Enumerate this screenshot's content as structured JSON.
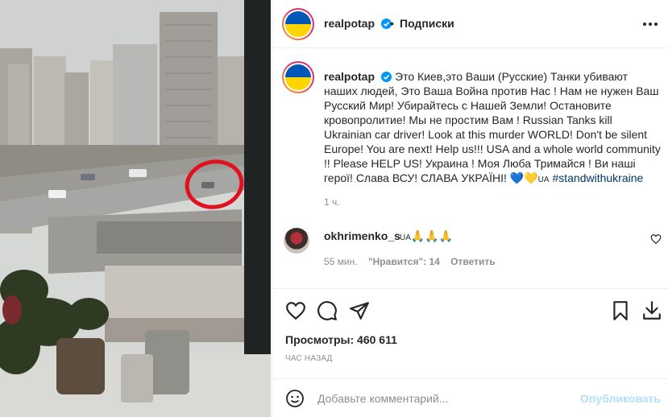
{
  "header": {
    "username": "realpotap",
    "separator": "•",
    "follow_label": "Подписки",
    "more_icon": "more-horizontal-icon"
  },
  "caption": {
    "username": "realpotap",
    "text_main": "Это Киев,это Ваши (Русские) Танки убивают наших людей, Это Ваша Война против Нас ! Нам не нужен Ваш Русский Мир! Убирайтесь с Нашей Земли! Остановите кровопролитие! Мы не простим Вам ! Russian Tanks kill Ukrainian car driver! Look at this murder WORLD! Don't be silent Europe! You are next! Help us!!! USA and a whole world community !! Please HELP US! Украина ! Моя Люба Тримайся ! Ви наші герої! Слава ВСУ! СЛАВА УКРАЇНІ!",
    "emoji": "💙💛",
    "flag_text": "UA",
    "hashtag": "#standwithukraine",
    "time": "1 ч."
  },
  "comment": {
    "username": "okhrimenko_s",
    "flag_text": "UA",
    "emoji": "🙏🙏🙏",
    "time": "55 мин.",
    "likes_label": "\"Нравится\": 14",
    "reply_label": "Ответить"
  },
  "actions": {
    "like_icon": "heart-icon",
    "comment_icon": "comment-icon",
    "share_icon": "send-icon",
    "save_icon": "bookmark-icon",
    "download_icon": "download-icon"
  },
  "views": "Просмотры: 460 611",
  "posted": "ЧАС НАЗАД",
  "add_comment": {
    "placeholder": "Добавьте комментарий...",
    "publish_label": "Опубликовать"
  },
  "colors": {
    "accent": "#0095f6",
    "publish_disabled": "#b2dffc",
    "hashtag": "#00376b",
    "muted": "#8e8e8e",
    "annotation_circle": "#e0121f",
    "flag_blue": "#0057b7",
    "flag_yellow": "#ffd500"
  }
}
